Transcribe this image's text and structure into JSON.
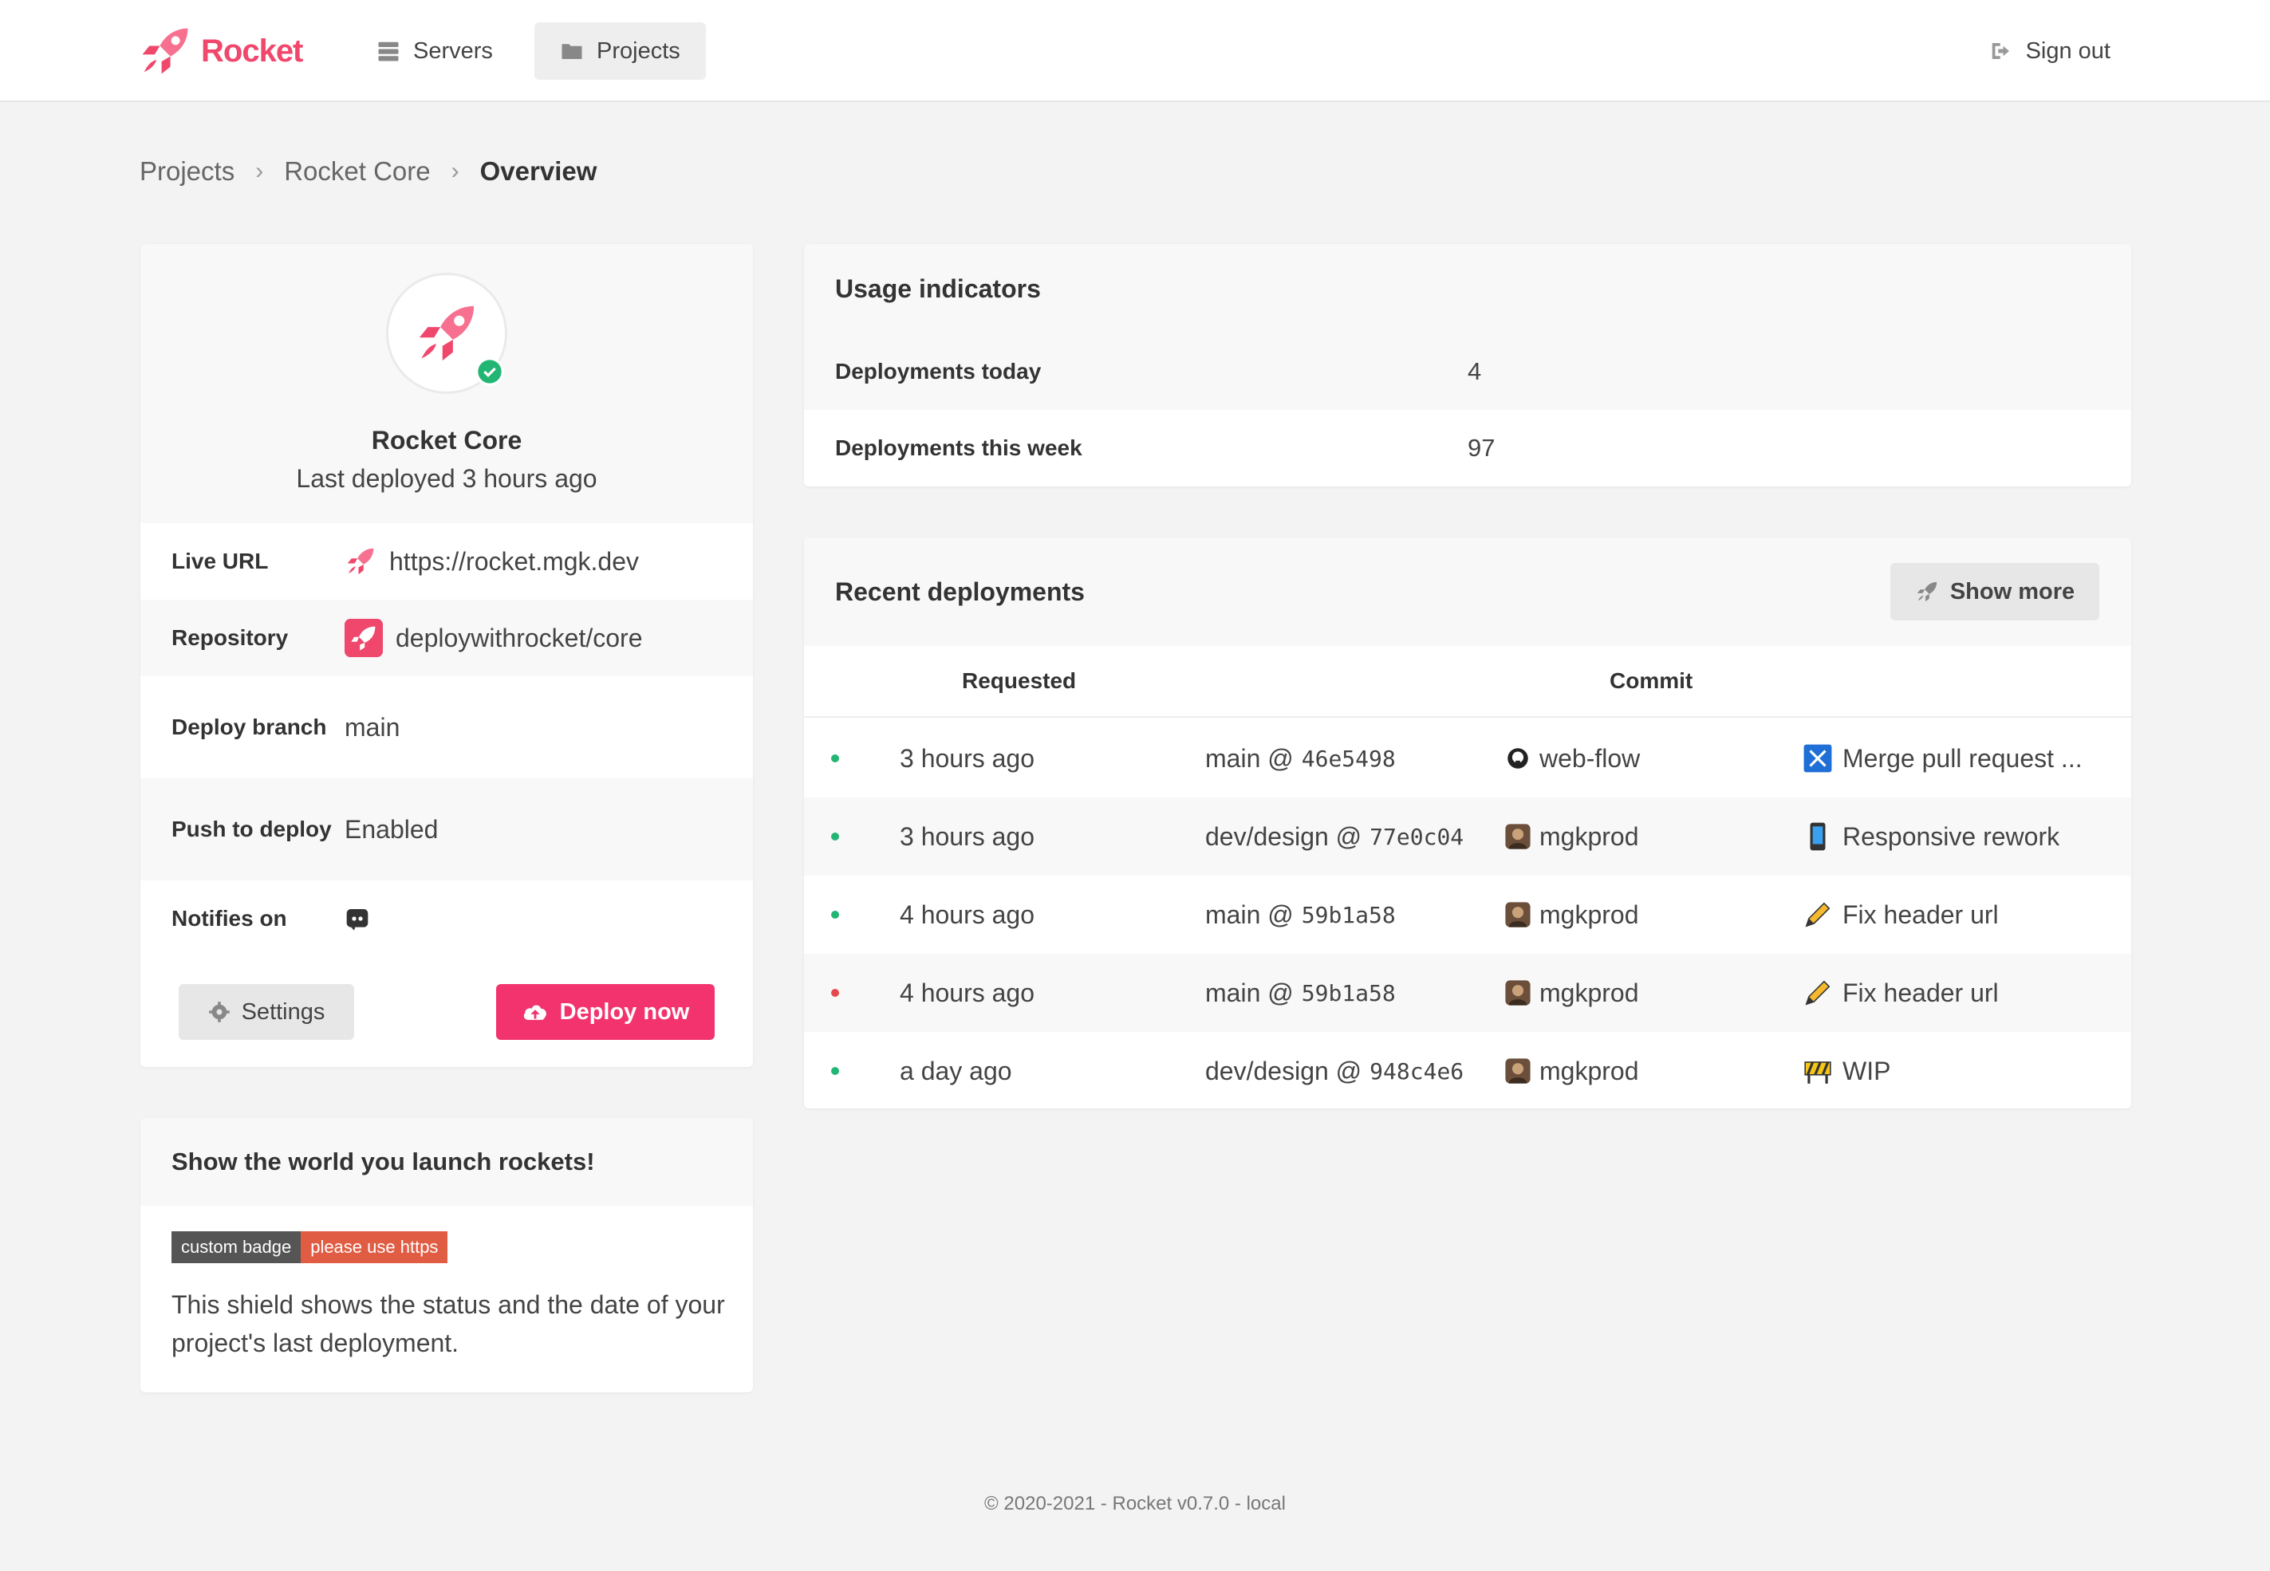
{
  "nav": {
    "brand": "Rocket",
    "servers": "Servers",
    "projects": "Projects",
    "sign_out": "Sign out"
  },
  "breadcrumb": [
    "Projects",
    "Rocket Core",
    "Overview"
  ],
  "project": {
    "name": "Rocket Core",
    "subtitle": "Last deployed 3 hours ago",
    "status": "healthy",
    "rows": [
      {
        "label": "Live URL",
        "value": "https://rocket.mgk.dev",
        "icon": "rocket-icon"
      },
      {
        "label": "Repository",
        "value": "deploywithrocket/core",
        "icon": "repo-rocket-icon"
      },
      {
        "label": "Deploy branch",
        "value": "main"
      },
      {
        "label": "Push to deploy",
        "value": "Enabled"
      },
      {
        "label": "Notifies on",
        "value": "",
        "icon": "discord-icon"
      }
    ],
    "settings_label": "Settings",
    "deploy_label": "Deploy now"
  },
  "badge_card": {
    "title": "Show the world you launch rockets!",
    "shield_left": "custom badge",
    "shield_right": "please use https",
    "description": "This shield shows the status and the date of your project's last deployment."
  },
  "usage": {
    "title": "Usage indicators",
    "rows": [
      {
        "label": "Deployments today",
        "value": "4"
      },
      {
        "label": "Deployments this week",
        "value": "97"
      }
    ]
  },
  "deployments": {
    "title": "Recent deployments",
    "show_more": "Show more",
    "headers": {
      "requested": "Requested",
      "commit": "Commit"
    },
    "rows": [
      {
        "status": "success",
        "status_color": "#22b573",
        "time": "3 hours ago",
        "branch": "main @",
        "sha": "46e5498",
        "author": "web-flow",
        "author_icon": "github-icon",
        "message": "Merge pull request ...",
        "message_icon": "merge-icon"
      },
      {
        "status": "success",
        "status_color": "#22b573",
        "time": "3 hours ago",
        "branch": "dev/design @",
        "sha": "77e0c04",
        "author": "mgkprod",
        "author_icon": "user-avatar-icon",
        "message": "Responsive rework",
        "message_icon": "mobile-phone-icon"
      },
      {
        "status": "success",
        "status_color": "#22b573",
        "time": "4 hours ago",
        "branch": "main @",
        "sha": "59b1a58",
        "author": "mgkprod",
        "author_icon": "user-avatar-icon",
        "message": "Fix header url",
        "message_icon": "pencil-icon"
      },
      {
        "status": "failed",
        "status_color": "#e5484d",
        "time": "4 hours ago",
        "branch": "main @",
        "sha": "59b1a58",
        "author": "mgkprod",
        "author_icon": "user-avatar-icon",
        "message": "Fix header url",
        "message_icon": "pencil-icon"
      },
      {
        "status": "success",
        "status_color": "#22b573",
        "time": "a day ago",
        "branch": "dev/design @",
        "sha": "948c4e6",
        "author": "mgkprod",
        "author_icon": "user-avatar-icon",
        "message": "WIP",
        "message_icon": "construction-icon"
      }
    ]
  },
  "footer": "© 2020-2021 - Rocket v0.7.0 - local",
  "colors": {
    "brand": "#f0476d",
    "deploy_button": "#f2336e",
    "success": "#22b573",
    "failed": "#e5484d"
  }
}
